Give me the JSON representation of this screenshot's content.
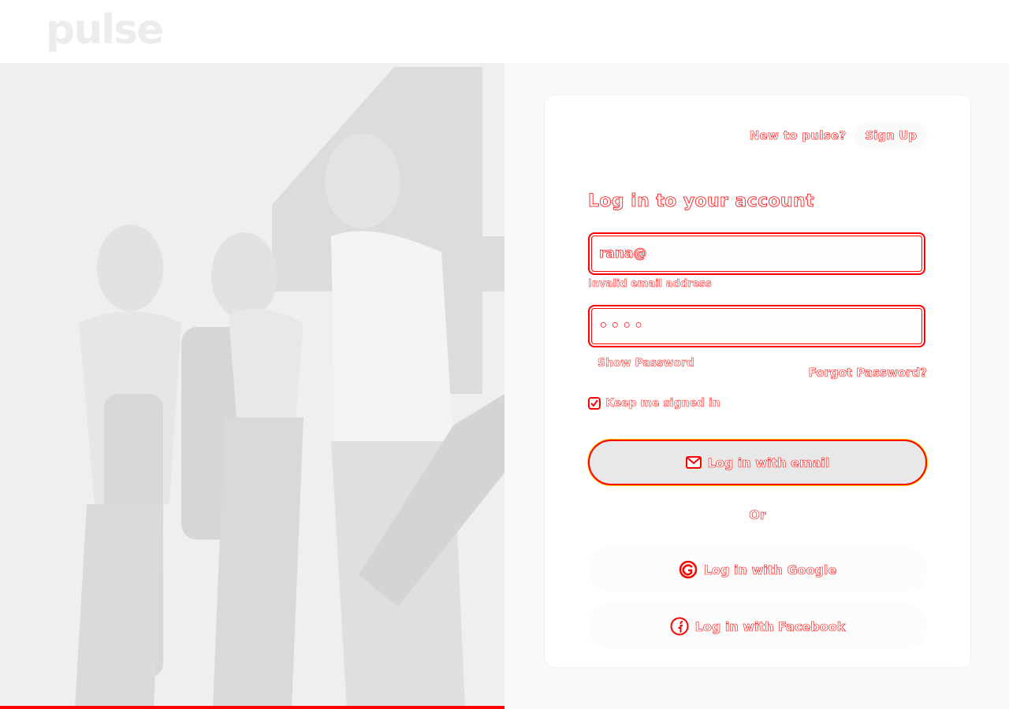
{
  "brand": {
    "logo_text": "pulse"
  },
  "hero": {
    "image_icon": "fitness-group-photo"
  },
  "signup": {
    "question": "New to pulse?",
    "button_label": "Sign Up"
  },
  "login": {
    "title": "Log in to your account",
    "email": {
      "value": "rana@",
      "error": "Invalid email address"
    },
    "password": {
      "value": "••••",
      "show_label": "Show Password"
    },
    "forgot_label": "Forgot Password?",
    "keep_signed_in": {
      "label": "Keep me signed in",
      "checked": true
    },
    "email_button": {
      "label": "Log in with email",
      "icon": "email-icon"
    },
    "or_label": "Or",
    "google_button": {
      "label": "Log in with Google",
      "icon": "google-icon"
    },
    "facebook_button": {
      "label": "Log in with Facebook",
      "icon": "facebook-icon"
    }
  },
  "colors": {
    "accent": "#ff0000",
    "highlight": "#ffd000"
  }
}
